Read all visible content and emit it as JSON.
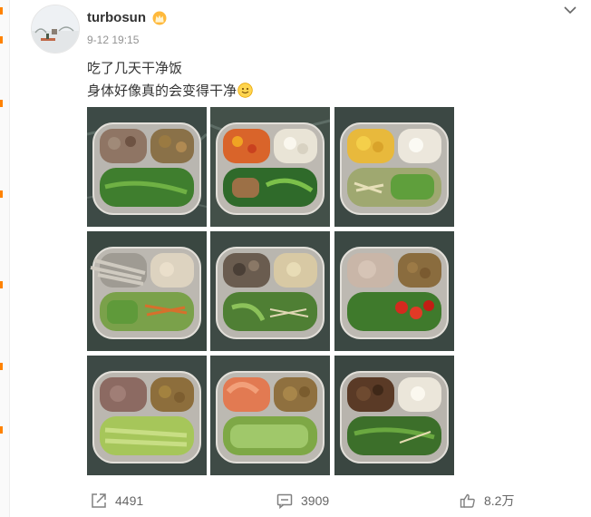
{
  "post": {
    "username": "turbosun",
    "time": "9-12 19:15",
    "text_line1": "吃了几天干净饭",
    "text_line2": "身体好像真的会变得干净"
  },
  "photos": [
    {
      "name": "photo-1",
      "dishes": [
        "braised-meat",
        "mushrooms",
        "leafy-greens"
      ]
    },
    {
      "name": "photo-2",
      "dishes": [
        "tomato-egg",
        "cauliflower",
        "fish-and-greens"
      ]
    },
    {
      "name": "photo-3",
      "dishes": [
        "scrambled-egg",
        "cauliflower",
        "noodles-and-greens"
      ]
    },
    {
      "name": "photo-4",
      "dishes": [
        "small-fish",
        "tofu",
        "greens-and-carrot"
      ]
    },
    {
      "name": "photo-5",
      "dishes": [
        "mushrooms",
        "mushroom-soup",
        "greens-and-noodles"
      ]
    },
    {
      "name": "photo-6",
      "dishes": [
        "sliced-meat",
        "mushrooms",
        "greens-and-peppers"
      ]
    },
    {
      "name": "photo-7",
      "dishes": [
        "sliced-meat",
        "mushrooms",
        "cabbage"
      ]
    },
    {
      "name": "photo-8",
      "dishes": [
        "shrimp",
        "mushrooms",
        "greens"
      ]
    },
    {
      "name": "photo-9",
      "dishes": [
        "braised-meat",
        "cauliflower",
        "greens-and-sprouts"
      ]
    }
  ],
  "actions": {
    "repost_count": "4491",
    "comment_count": "3909",
    "like_count": "8.2万"
  },
  "colors": {
    "text": "#333333",
    "secondary_text": "#939393",
    "action_text": "#666666",
    "accent": "#ff8200",
    "plate": "#b9b6b0",
    "marble": "#3d4a46"
  }
}
